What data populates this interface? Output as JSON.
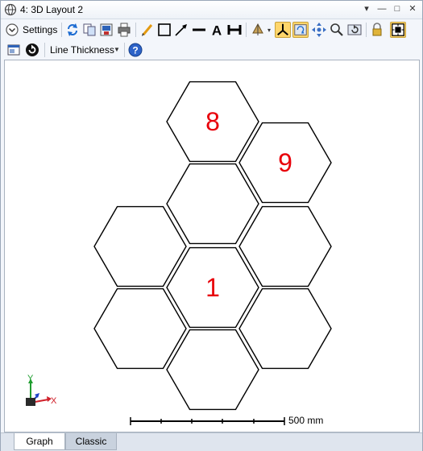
{
  "window": {
    "title": "4: 3D Layout 2",
    "controls": [
      "▾",
      "—",
      "□",
      "✕"
    ]
  },
  "toolbar": {
    "settings_label": "Settings",
    "line_thickness_label": "Line Thickness",
    "icons": [
      "chevron-down-icon",
      "refresh-icon",
      "copy-icon",
      "save-icon",
      "print-icon",
      "pencil-icon",
      "rectangle-icon",
      "arrow-icon",
      "line-icon",
      "text-icon",
      "dimension-icon",
      "rotate-icon",
      "axes-icon",
      "auto-rotate-icon",
      "pan-icon",
      "zoom-icon",
      "reset-view-icon",
      "lock-icon",
      "fit-view-icon"
    ]
  },
  "hexagons": [
    {
      "label": "8"
    },
    {
      "label": "9"
    },
    {
      "label": ""
    },
    {
      "label": ""
    },
    {
      "label": ""
    },
    {
      "label": "1"
    },
    {
      "label": ""
    },
    {
      "label": ""
    },
    {
      "label": ""
    }
  ],
  "axes": {
    "y_label": "Y",
    "x_label": "X",
    "colors": {
      "y": "#1f9d2f",
      "x": "#d0202a",
      "z": "#1c40c7"
    }
  },
  "scale_bar": {
    "label": "500 mm"
  },
  "tabs": {
    "graph": "Graph",
    "classic": "Classic"
  },
  "colors": {
    "label_red": "#e8000a",
    "active_tool": "#ffd66b"
  }
}
